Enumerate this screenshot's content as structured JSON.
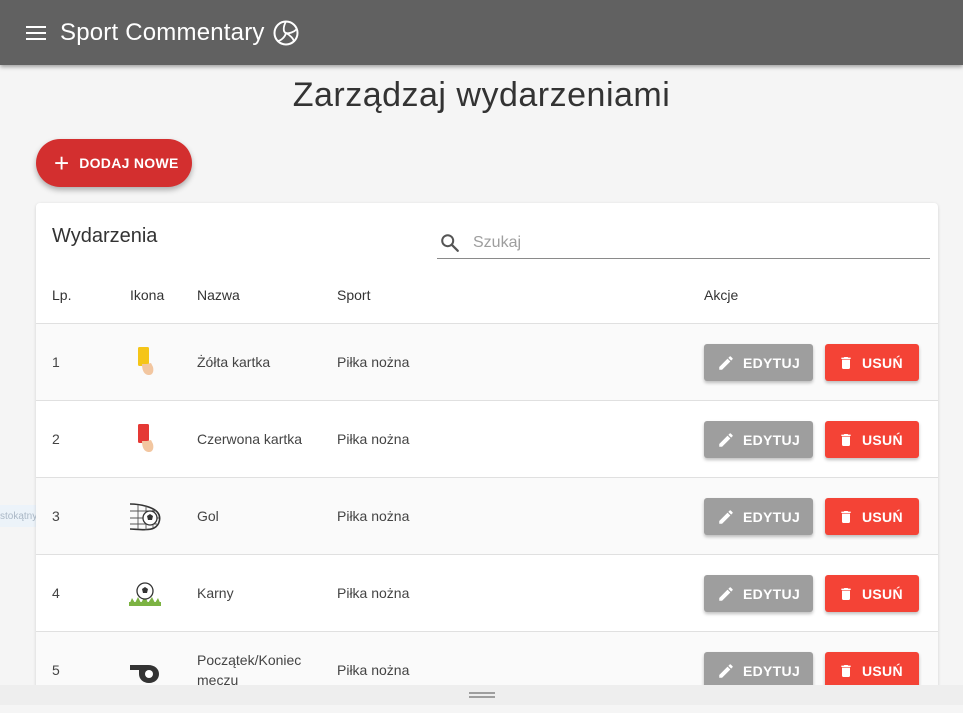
{
  "app": {
    "title": "Sport Commentary",
    "menu_icon": "menu-icon",
    "logo_icon": "volleyball-icon"
  },
  "page": {
    "title": "Zarządzaj wydarzeniami"
  },
  "add_button": {
    "label": "DODAJ NOWE",
    "icon": "plus-icon",
    "color": "#d32f2f"
  },
  "table": {
    "title": "Wydarzenia",
    "search": {
      "placeholder": "Szukaj",
      "value": "",
      "icon": "search-icon"
    },
    "columns": [
      "Lp.",
      "Ikona",
      "Nazwa",
      "Sport",
      "Akcje"
    ],
    "rows": [
      {
        "lp": "1",
        "icon": "yellow-card-icon",
        "name": "Żółta kartka",
        "sport": "Piłka nożna"
      },
      {
        "lp": "2",
        "icon": "red-card-icon",
        "name": "Czerwona kartka",
        "sport": "Piłka nożna"
      },
      {
        "lp": "3",
        "icon": "goal-net-icon",
        "name": "Gol",
        "sport": "Piłka nożna"
      },
      {
        "lp": "4",
        "icon": "penalty-ball-icon",
        "name": "Karny",
        "sport": "Piłka nożna"
      },
      {
        "lp": "5",
        "icon": "whistle-icon",
        "name": "Początek/Koniec meczu",
        "sport": "Piłka nożna"
      }
    ],
    "edit_label": "EDYTUJ",
    "delete_label": "USUŃ",
    "edit_color": "#9e9e9e",
    "delete_color": "#f44336"
  },
  "ghost_text": "stokątny"
}
